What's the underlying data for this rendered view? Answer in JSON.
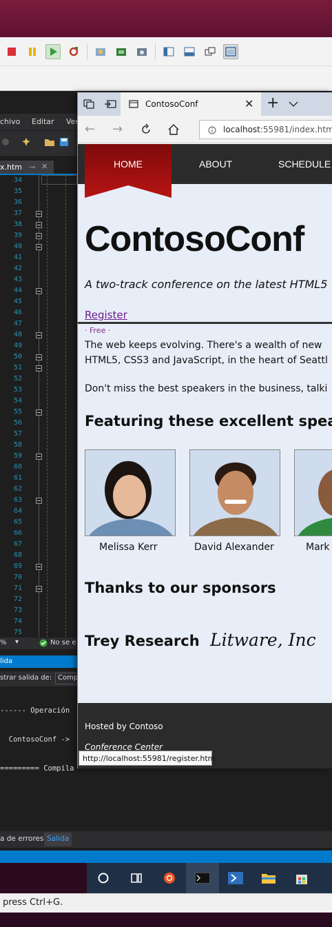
{
  "vs": {
    "menu": [
      "chivo",
      "Editar",
      "Ver"
    ],
    "open_tab": "x.htm",
    "line_numbers": [
      "34",
      "35",
      "36",
      "37",
      "38",
      "39",
      "40",
      "41",
      "42",
      "43",
      "44",
      "45",
      "46",
      "47",
      "48",
      "49",
      "50",
      "51",
      "52",
      "53",
      "54",
      "55",
      "56",
      "57",
      "58",
      "59",
      "60",
      "61",
      "62",
      "63",
      "64",
      "65",
      "66",
      "67",
      "68",
      "69",
      "70",
      "71",
      "72",
      "73",
      "74",
      "75"
    ],
    "zoom": "%",
    "status_issues": "No se e",
    "output_title": "lida",
    "show_output_from": "strar salida de:",
    "output_source": "Comp",
    "output_lines": [
      "------ Operación",
      "  ContosoConf ->",
      "========= Compila"
    ],
    "bottom_tabs": {
      "errors": "a de errores",
      "output": "Salida"
    },
    "status_hint": "press Ctrl+G."
  },
  "browser": {
    "tab_title": "ContosoConf",
    "url_host": "localhost",
    "url_rest": ":55981/index.htm",
    "tooltip": "http://localhost:55981/register.htm"
  },
  "site": {
    "nav": [
      "HOME",
      "ABOUT",
      "SCHEDULE"
    ],
    "title": "ContosoConf",
    "tagline": "A two-track conference on the latest HTML5",
    "register": "Register",
    "free": "· Free ·",
    "para1_line1": "The web keeps evolving. There's a wealth of new",
    "para1_line2": "HTML5, CSS3 and JavaScript, in the heart of Seattl",
    "para2": "Don't miss the best speakers in the business, talki",
    "speakers_heading": "Featuring these excellent speake",
    "speakers": [
      "Melissa Kerr",
      "David Alexander",
      "Mark"
    ],
    "sponsors_heading": "Thanks to our sponsors",
    "sponsors": [
      "Trey Research",
      "Litware, Inc"
    ],
    "footer_hosted": "Hosted by Contoso",
    "footer_venue": "Conference Center"
  },
  "colors": {
    "accent": "#007acc",
    "nav_bg": "#2b2b2b",
    "home_red": "#a50e0e",
    "page_bg": "#e8eef8"
  }
}
